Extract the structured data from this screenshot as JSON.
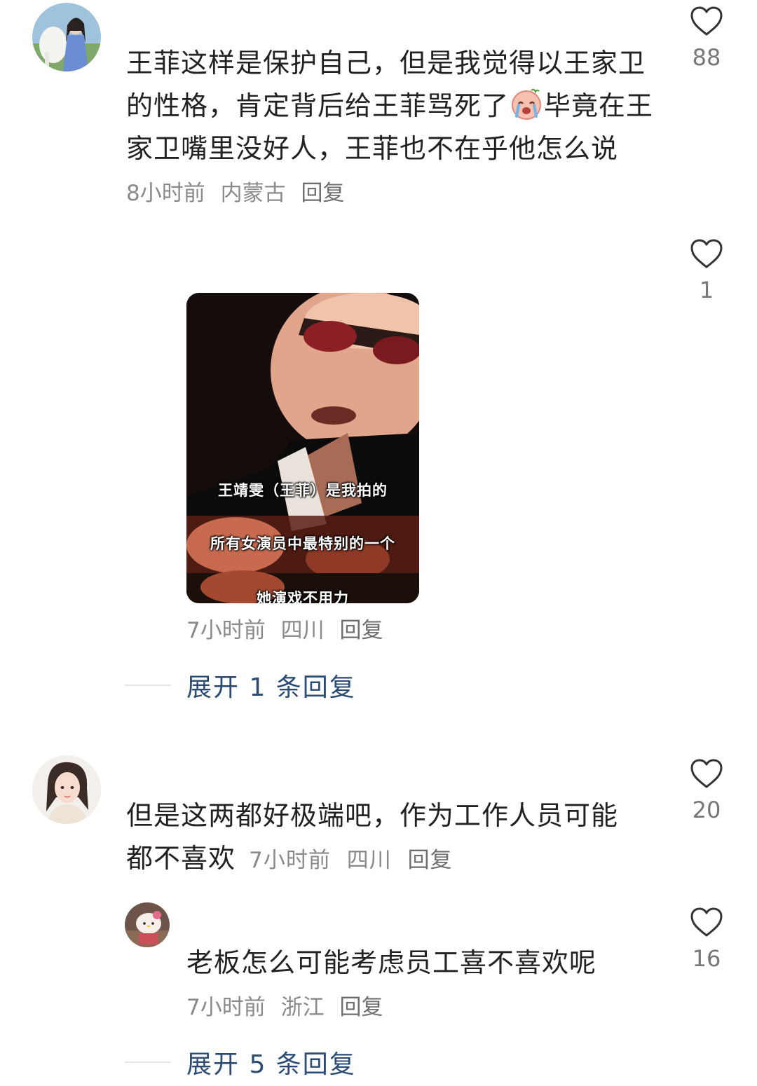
{
  "comments": [
    {
      "text_before_emoji": "王菲这样是保护自己，但是我觉得以王家卫的性格，肯定背后给王菲骂死了",
      "emoji": "crying-face-emoji",
      "text_after_emoji": "毕竟在王家卫嘴里没好人，王菲也不在乎他怎么说",
      "time": "8小时前",
      "location": "内蒙古",
      "reply_label": "回复",
      "likes": "88"
    },
    {
      "image_captions": [
        "王靖雯（王菲）是我拍的",
        "所有女演员中最特别的一个",
        "她演戏不用力"
      ],
      "time": "7小时前",
      "location": "四川",
      "reply_label": "回复",
      "likes": "1",
      "expand_label": "展开 1 条回复"
    },
    {
      "text": "但是这两都好极端吧，作为工作人员可能都不喜欢",
      "time": "7小时前",
      "location": "四川",
      "reply_label": "回复",
      "likes": "20"
    },
    {
      "text": "老板怎么可能考虑员工喜不喜欢呢",
      "time": "7小时前",
      "location": "浙江",
      "reply_label": "回复",
      "likes": "16",
      "expand_label": "展开 5 条回复"
    }
  ],
  "colors": {
    "text": "#222222",
    "meta": "#8a8a8a",
    "link": "#2b4a74",
    "like_icon": "#333333"
  },
  "icons": {
    "like": "heart-outline-icon"
  }
}
